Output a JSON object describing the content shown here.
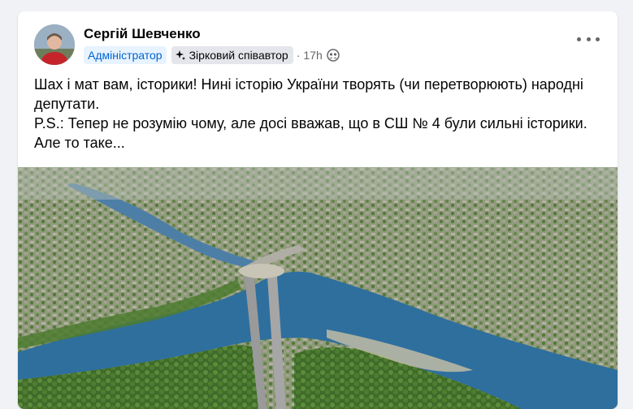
{
  "post": {
    "author": "Сергій Шевченко",
    "badge_admin": "Адміністратор",
    "badge_star": "Зірковий співавтор",
    "separator": "·",
    "time": "17h",
    "audience_icon": "group-audience-icon",
    "more_icon": "more-options-icon",
    "text_lines": [
      "Шах і мат вам, історики! Нині історію України творять (чи перетворюють) народні депутати.",
      "P.S.: Тепер не розумію чому, але досі вважав, що в СШ № 4 були сильні історики. Але то таке..."
    ]
  },
  "colors": {
    "admin_badge_bg": "#e7f3ff",
    "admin_badge_text": "#0064d1",
    "river": "#2e6f9e",
    "greenery": "#5a8a3a"
  }
}
